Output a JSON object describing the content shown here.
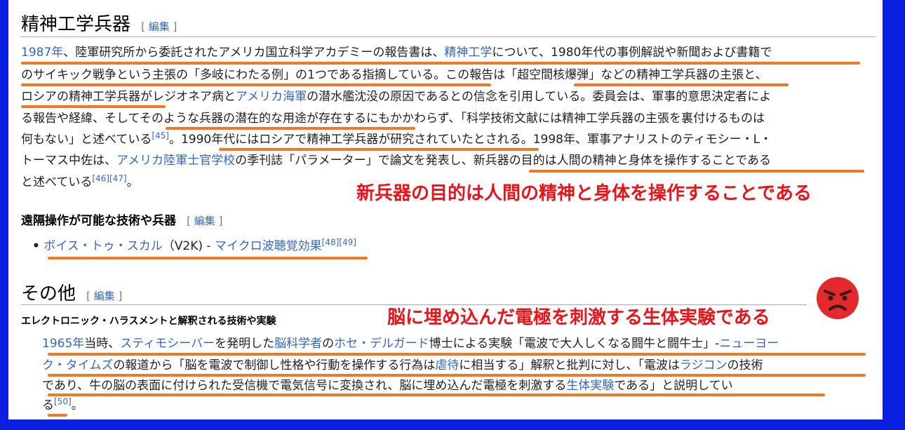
{
  "section1": {
    "title": "精神工学兵器",
    "edit_open": "[",
    "edit_label": "編集",
    "edit_close": "]"
  },
  "para1": {
    "l1": {
      "a": "1987年",
      "b": "、陸軍研究所から委託されたアメリカ国立科学アカデミーの報告書は、",
      "c": "精神工学",
      "d": "について、1980年代の事例解説や新聞および書籍で"
    },
    "l2": {
      "a": "のサイキック戦争という主張の「多岐にわたる例」の1つである指摘している。この報告は「超空間核爆弾」などの精神工学兵器の主張と、"
    },
    "l3": {
      "a": "ロシアの精神工学兵器がレジオネア病と",
      "b": "アメリカ海軍",
      "c": "の潜水艦沈没の原因であるとの信念を引用している。委員会は、軍事的意思決定者によ"
    },
    "l4": {
      "a": "る報告や経緯、そしてそのような兵器の潜在的な用途が存在するにもかかわらず、「科学技術文献には精神工学兵器の主張を裏付けるものは"
    },
    "l5": {
      "a": "何もない」と述べている",
      "ref": "[45]",
      "b": "。1990年代にはロシアで精神工学兵器が研究されていたとされる。1998年、軍事アナリストのティモシー・L・"
    },
    "l6": {
      "a": "トーマス中佐は、",
      "b": "アメリカ陸軍士官学校",
      "c": "の季刊誌「パラメーター」で論文を発表し、新兵器の目的は人間の精神と身体を操作することである"
    },
    "l7": {
      "a": "と述べている",
      "ref": "[46][47]",
      "b": "。"
    }
  },
  "callout1": "新兵器の目的は人間の精神と身体を操作することである",
  "section2": {
    "title": "遠隔操作が可能な技術や兵器",
    "edit_open": "[",
    "edit_label": "編集",
    "edit_close": "]"
  },
  "bullet1": {
    "a": "ボイス・トゥ・スカル",
    "b": "（V2K) - ",
    "c": "マイクロ波聴覚効果",
    "ref": "[48][49]"
  },
  "section3": {
    "title": "その他",
    "edit_open": "[",
    "edit_label": "編集",
    "edit_close": "]"
  },
  "section4": {
    "title": "エレクトロニック・ハラスメントと解釈される技術や実験"
  },
  "callout2": "脳に埋め込んだ電極を刺激する生体実験である",
  "para2": {
    "l1": {
      "a": "1965年",
      "b": "当時、",
      "c": "スティモシーバー",
      "d": "を発明した",
      "e": "脳科学者",
      "f": "の",
      "g": "ホセ・デルガード",
      "h": "博士による実験「電波で大人しくなる闘牛と闘牛士」-",
      "i": "ニューヨー"
    },
    "l2": {
      "a": "ク・タイムズ",
      "b": "の報道から「脳を電波で制御し性格や行動を操作する行為は",
      "c": "虐待",
      "d": "に相当する」解釈と批判に対し、「電波は",
      "e": "ラジコン",
      "f": "の技術"
    },
    "l3": {
      "a": "であり、牛の脳の表面に付けられた受信機で電気信号に変換され、脳に埋め込んだ電極を刺激する",
      "b": "生体実験",
      "c": "である」と説明してい"
    },
    "l4": {
      "a": "る",
      "ref": "[50]",
      "b": "。"
    }
  },
  "angry_face_icon": "angry-face-icon",
  "colors": {
    "frame": "#0a1fe0",
    "link": "#3366cc",
    "underline": "#f07a24",
    "callout": "#e8141b"
  }
}
